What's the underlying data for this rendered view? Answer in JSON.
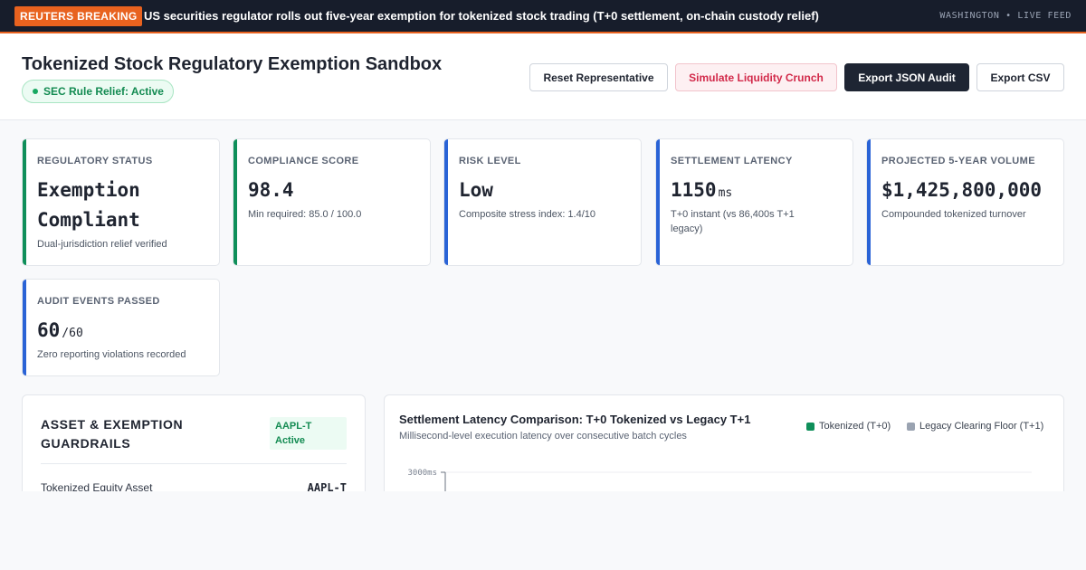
{
  "ticker": {
    "badge": "REUTERS BREAKING",
    "headline": "US securities regulator rolls out five-year exemption for tokenized stock trading (T+0 settlement, on-chain custody relief)",
    "feed": "WASHINGTON • LIVE FEED"
  },
  "header": {
    "title": "Tokenized Stock Regulatory Exemption Sandbox",
    "status": "SEC Rule Relief: Active",
    "buttons": {
      "reset": "Reset Representative",
      "crunch": "Simulate Liquidity Crunch",
      "json": "Export JSON Audit",
      "csv": "Export CSV"
    }
  },
  "colors": {
    "green_accent": "#0f8f5a",
    "blue_accent": "#2a63d6",
    "ticker_orange": "#e8621f",
    "danger": "#d22a4a"
  },
  "metrics": [
    {
      "label": "REGULATORY STATUS",
      "value": "Exemption Compliant",
      "unit": "",
      "sub": "Dual-jurisdiction relief verified"
    },
    {
      "label": "COMPLIANCE SCORE",
      "value": "98.4",
      "unit": "",
      "sub": "Min required: 85.0 / 100.0"
    },
    {
      "label": "RISK LEVEL",
      "value": "Low",
      "unit": "",
      "sub": "Composite stress index: 1.4/10"
    },
    {
      "label": "SETTLEMENT LATENCY",
      "value": "1150",
      "unit": "ms",
      "sub": "T+0 instant (vs 86,400s T+1 legacy)"
    },
    {
      "label": "PROJECTED 5-YEAR VOLUME",
      "value": "$1,425,800,000",
      "unit": "",
      "sub": "Compounded tokenized turnover"
    },
    {
      "label": "AUDIT EVENTS PASSED",
      "value": "60",
      "unit": "/60",
      "sub": "Zero reporting violations recorded"
    }
  ],
  "guardrails": {
    "title": "ASSET & EXEMPTION GUARDRAILS",
    "badge": "AAPL-T Active",
    "rows": [
      {
        "label": "Tokenized Equity Asset",
        "value": "AAPL-T"
      }
    ]
  },
  "chart": {
    "title": "Settlement Latency Comparison: T+0 Tokenized vs Legacy T+1",
    "subtitle": "Millisecond-level execution latency over consecutive batch cycles",
    "legend": [
      "Tokenized (T+0)",
      "Legacy Clearing Floor (T+1)"
    ]
  },
  "chart_data": {
    "type": "line",
    "title": "Settlement Latency Comparison: T+0 Tokenized vs Legacy T+1",
    "subtitle": "Millisecond-level execution latency over consecutive batch cycles",
    "series": [
      {
        "name": "Tokenized (T+0)",
        "values": []
      },
      {
        "name": "Legacy Clearing Floor (T+1)",
        "values": []
      }
    ],
    "y_tick_labels": [
      "3000ms"
    ],
    "grid": true,
    "legend": "top-right"
  }
}
